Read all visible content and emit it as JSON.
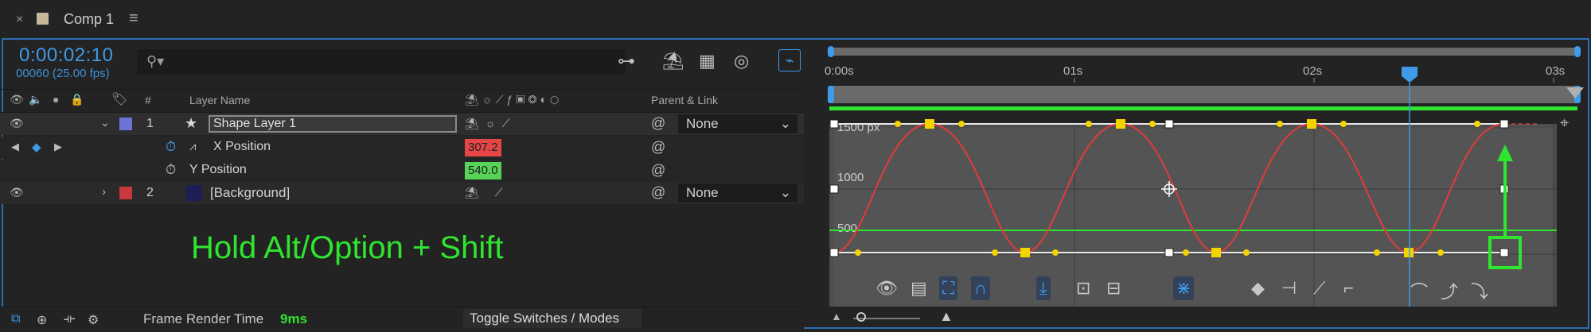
{
  "tab": {
    "close": "×",
    "title": "Comp 1",
    "menu": "≡"
  },
  "timecode": "0:00:02:10",
  "frames_fps": "00060 (25.00 fps)",
  "search": {
    "icon": "search-icon",
    "value": ""
  },
  "columns": {
    "num": "#",
    "layer_name": "Layer Name",
    "parent_link": "Parent & Link"
  },
  "layers": [
    {
      "index": "1",
      "name": "Shape Layer 1",
      "color": "#6b72d8",
      "parent": "None"
    },
    {
      "index": "2",
      "name": "[Background]",
      "color": "#c8383c",
      "parent": "None"
    }
  ],
  "properties": [
    {
      "name": "X Position",
      "value": "307.2",
      "value_color": "#e64646"
    },
    {
      "name": "Y Position",
      "value": "540.0",
      "value_color": "#57d357"
    }
  ],
  "caption": "Hold Alt/Option + Shift",
  "status": {
    "label": "Frame Render Time",
    "value": "9ms",
    "toggle": "Toggle Switches / Modes"
  },
  "ruler": {
    "ticks": [
      "0:00s",
      "01s",
      "02s",
      "03s"
    ]
  },
  "graph_labels": {
    "y1500": "1500 px",
    "y1000": "1000",
    "y500": "500"
  },
  "colors": {
    "accent": "#3f9ae8",
    "curve": "#e23b3b",
    "key": "#f2d400",
    "green": "#2fe52f",
    "outline": "#2d6fb6"
  }
}
